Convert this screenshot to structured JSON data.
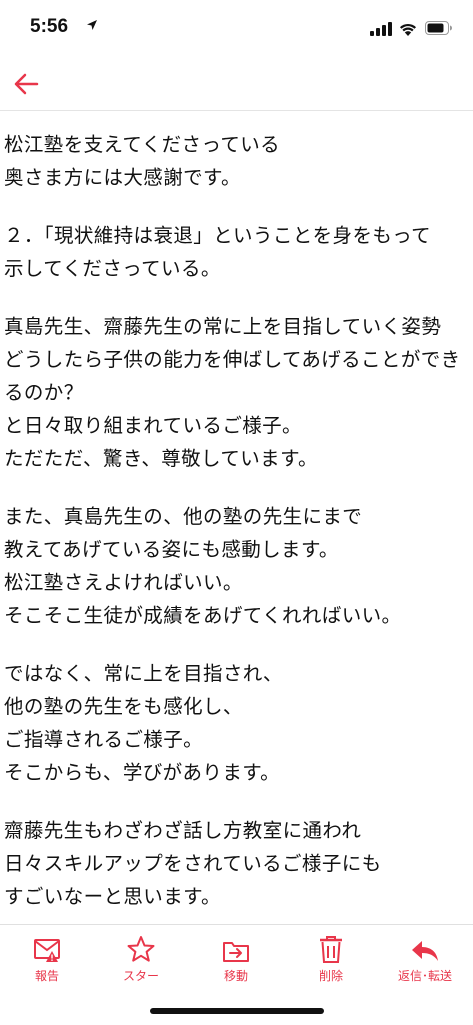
{
  "status_bar": {
    "time": "5:56"
  },
  "message": {
    "paragraphs": [
      [
        "松江塾を支えてくださっている",
        "奥さま方には大感謝です。"
      ],
      [
        "２．「現状維持は衰退」ということを身をもって",
        "示してくださっている。"
      ],
      [
        "真島先生、齋藤先生の常に上を目指していく姿勢",
        "どうしたら子供の能力を伸ばしてあげることができ",
        "るのか？",
        "と日々取り組まれているご様子。",
        "ただただ、驚き、尊敬しています。"
      ],
      [
        "また、真島先生の、他の塾の先生にまで",
        "教えてあげている姿にも感動します。",
        "松江塾さえよければいい。",
        "そこそこ生徒が成績をあげてくれればいい。"
      ],
      [
        "ではなく、常に上を目指され、",
        "他の塾の先生をも感化し、",
        "ご指導されるご様子。",
        "そこからも、学びがあります。"
      ],
      [
        "齋藤先生もわざわざ話し方教室に通われ",
        "日々スキルアップをされているご様子にも",
        "すごいなーと思います。"
      ]
    ]
  },
  "toolbar": {
    "accent_color": "#e8364a",
    "items": [
      {
        "label": "報告",
        "icon": "report-icon"
      },
      {
        "label": "スター",
        "icon": "star-icon"
      },
      {
        "label": "移動",
        "icon": "move-icon"
      },
      {
        "label": "削除",
        "icon": "trash-icon"
      },
      {
        "label": "返信･転送",
        "icon": "reply-icon"
      }
    ]
  }
}
